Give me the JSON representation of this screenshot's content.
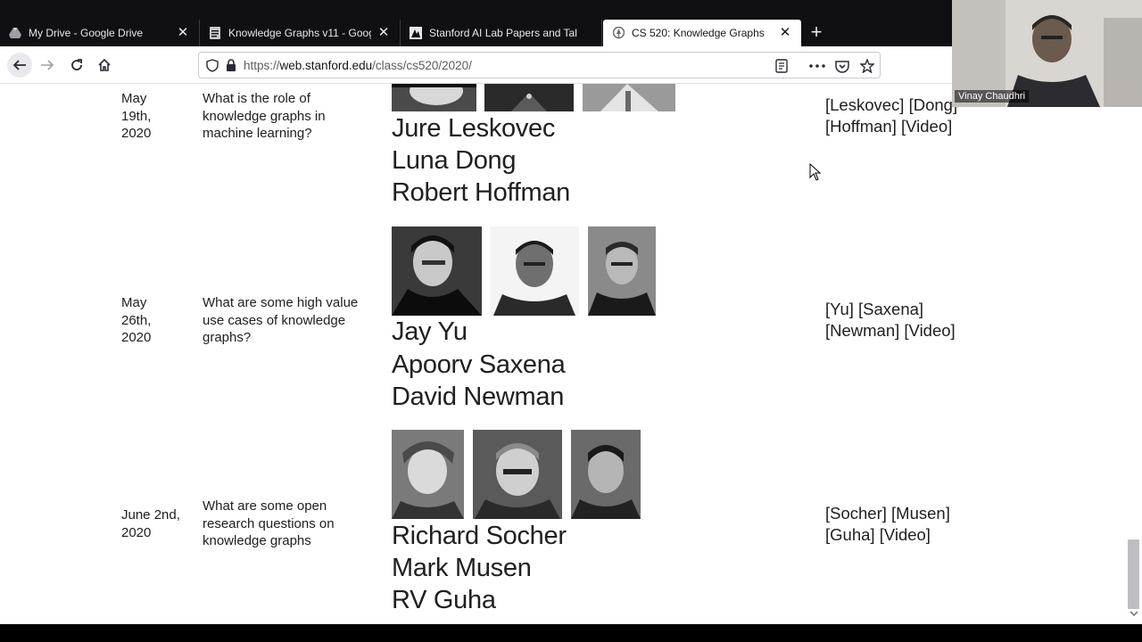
{
  "browser": {
    "tabs": [
      {
        "title": "My Drive - Google Drive",
        "icon": "google-drive-icon",
        "active": false
      },
      {
        "title": "Knowledge Graphs v11 - Goog",
        "icon": "google-docs-icon",
        "active": false
      },
      {
        "title": "Stanford AI Lab Papers and Tal",
        "icon": "stanford-ai-lab-icon",
        "active": false
      },
      {
        "title": "CS 520: Knowledge Graphs",
        "icon": "stanford-tree-icon",
        "active": true
      }
    ],
    "new_tab_label": "+",
    "close_label": "✕",
    "url_prefix": "https://",
    "url_host": "web.stanford.edu",
    "url_path": "/class/cs520/2020/"
  },
  "schedule": [
    {
      "date": "May\n19th,\n2020",
      "question": "What is the role of knowledge graphs in machine learning?",
      "speakers": [
        "Jure Leskovec",
        "Luna Dong",
        "Robert Hoffman"
      ],
      "links": [
        "[Leskovec]",
        "[Dong]",
        "[Hoffman]",
        "[Video]"
      ]
    },
    {
      "date": "May\n26th,\n2020",
      "question": "What are some high value use cases of knowledge graphs?",
      "speakers": [
        "Jay Yu",
        "Apoorv Saxena",
        "David Newman"
      ],
      "links": [
        "[Yu]",
        "[Saxena]",
        "[Newman]",
        "[Video]"
      ]
    },
    {
      "date": "June 2nd,\n2020",
      "question": "What are some open research questions on knowledge graphs",
      "speakers": [
        "Richard Socher",
        "Mark Musen",
        "RV Guha"
      ],
      "links": [
        "[Socher]",
        "[Musen]",
        "[Guha]",
        "[Video]"
      ]
    }
  ],
  "webcam": {
    "participant_name": "Vinay Chaudhri"
  },
  "colors": {
    "tabbar_bg": "#101013",
    "page_bg": "#ffffff",
    "text": "#202020",
    "url_host": "#15141a",
    "url_muted": "#5b5b66"
  }
}
